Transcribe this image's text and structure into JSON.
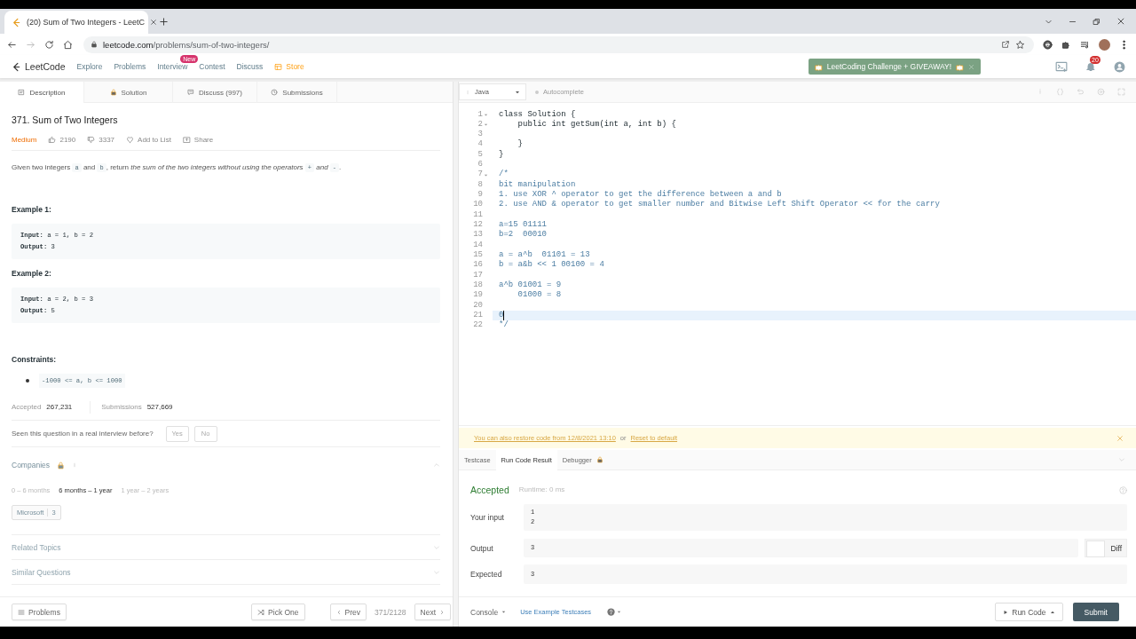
{
  "browser": {
    "tab_title": "(20) Sum of Two Integers - LeetC",
    "url_host": "leetcode.com",
    "url_path": "/problems/sum-of-two-integers/"
  },
  "nav": {
    "logo": "LeetCode",
    "items": [
      {
        "label": "Explore",
        "kind": "link"
      },
      {
        "label": "Problems",
        "kind": "link"
      },
      {
        "label": "Interview",
        "kind": "link",
        "badge": "New"
      },
      {
        "label": "Contest",
        "kind": "link"
      },
      {
        "label": "Discuss",
        "kind": "link"
      },
      {
        "label": "Store",
        "kind": "store"
      }
    ],
    "promo": "LeetCoding Challenge + GIVEAWAY!",
    "notifications": "20"
  },
  "left_tabs": [
    {
      "label": "Description",
      "selected": true
    },
    {
      "label": "Solution",
      "selected": false
    },
    {
      "label": "Discuss (997)",
      "selected": false
    },
    {
      "label": "Submissions",
      "selected": false
    }
  ],
  "problem": {
    "title": "371. Sum of Two Integers",
    "difficulty": "Medium",
    "likes": "2190",
    "dislikes": "3337",
    "add_to_list": "Add to List",
    "share": "Share",
    "description": [
      {
        "kind": "text",
        "text": "Given two integers "
      },
      {
        "kind": "code",
        "text": "a"
      },
      {
        "kind": "text",
        "text": " and "
      },
      {
        "kind": "code",
        "text": "b"
      },
      {
        "kind": "text",
        "text": ", return "
      },
      {
        "kind": "italic",
        "text": "the sum of the two integers without using the operators "
      },
      {
        "kind": "code",
        "text": "+"
      },
      {
        "kind": "italic",
        "text": " and "
      },
      {
        "kind": "code",
        "text": "-"
      },
      {
        "kind": "text",
        "text": "."
      }
    ],
    "examples": [
      {
        "heading": "Example 1:",
        "lines": [
          "**Input:** a = 1, b = 2",
          "**Output:** 3"
        ]
      },
      {
        "heading": "Example 2:",
        "lines": [
          "**Input:** a = 2, b = 3",
          "**Output:** 5"
        ]
      }
    ],
    "constraints_heading": "Constraints:",
    "constraints": [
      "-1000 <= a, b <= 1000"
    ],
    "accepted_label": "Accepted",
    "accepted": "267,231",
    "submissions_label": "Submissions",
    "submissions": "527,669",
    "interview_question": "Seen this question in a real interview before?",
    "answers": [
      "Yes",
      "No"
    ]
  },
  "companies": {
    "title": "Companies",
    "expanded": true,
    "periods": [
      {
        "label": "0 – 6 months",
        "selected": false
      },
      {
        "label": "6 months – 1 year",
        "selected": true
      },
      {
        "label": "1 year – 2 years",
        "selected": false
      }
    ],
    "tags": [
      {
        "name": "Microsoft",
        "count": "3"
      }
    ]
  },
  "sections": [
    {
      "title": "Related Topics",
      "expanded": false
    },
    {
      "title": "Similar Questions",
      "expanded": false
    }
  ],
  "left_footer": {
    "problems": "Problems",
    "pick_one": "Pick One",
    "prev": "Prev",
    "position": "371/2128",
    "next": "Next"
  },
  "editor": {
    "language": "Java",
    "autocomplete": {
      "label": "Autocomplete",
      "on": false
    },
    "lines": [
      {
        "number": "1",
        "text": "class Solution {",
        "kind": "code",
        "fold": true,
        "current": false
      },
      {
        "number": "2",
        "text": "    public int getSum(int a, int b) {",
        "kind": "code",
        "fold": true,
        "current": false
      },
      {
        "number": "3",
        "fold": false,
        "current": false
      },
      {
        "number": "4",
        "text": "    }",
        "kind": "code",
        "fold": false,
        "current": false
      },
      {
        "number": "5",
        "text": "}",
        "kind": "code",
        "fold": false,
        "current": false
      },
      {
        "number": "6",
        "fold": false,
        "current": false
      },
      {
        "number": "7",
        "text": "/*",
        "kind": "comment",
        "fold": true,
        "current": false
      },
      {
        "number": "8",
        "text": "bit manipulation",
        "kind": "comment",
        "fold": false,
        "current": false
      },
      {
        "number": "9",
        "text": "1. use XOR ^ operator to get the difference between a and b",
        "kind": "comment",
        "fold": false,
        "current": false
      },
      {
        "number": "10",
        "text": "2. use AND & operator to get smaller number and Bitwise Left Shift Operator << for the carry",
        "kind": "comment",
        "fold": false,
        "current": false
      },
      {
        "number": "11",
        "fold": false,
        "current": false
      },
      {
        "number": "12",
        "text": "a=15 01111",
        "kind": "comment",
        "fold": false,
        "current": false
      },
      {
        "number": "13",
        "text": "b=2  00010",
        "kind": "comment",
        "fold": false,
        "current": false
      },
      {
        "number": "14",
        "fold": false,
        "current": false
      },
      {
        "number": "15",
        "text": "a = a^b  01101 = 13",
        "kind": "comment",
        "fold": false,
        "current": false
      },
      {
        "number": "16",
        "text": "b = a&b << 1 00100 = 4",
        "kind": "comment",
        "fold": false,
        "current": false
      },
      {
        "number": "17",
        "fold": false,
        "current": false
      },
      {
        "number": "18",
        "text": "a^b 01001 = 9",
        "kind": "comment",
        "fold": false,
        "current": false
      },
      {
        "number": "19",
        "text": "    01000 = 8",
        "kind": "comment",
        "fold": false,
        "current": false
      },
      {
        "number": "20",
        "fold": false,
        "current": false
      },
      {
        "number": "21",
        "text": "0",
        "kind": "comment",
        "fold": false,
        "current": true
      },
      {
        "number": "22",
        "text": "*/",
        "kind": "comment",
        "fold": false,
        "current": false
      }
    ]
  },
  "restore": {
    "message": "You can also restore code from 12/8/2021 13:10",
    "or": "or",
    "reset": "Reset to default"
  },
  "result_tabs": [
    {
      "label": "Testcase",
      "selected": false
    },
    {
      "label": "Run Code Result",
      "selected": true
    },
    {
      "label": "Debugger",
      "selected": false
    }
  ],
  "result": {
    "status": "Accepted",
    "runtime": "Runtime: 0 ms",
    "rows": [
      {
        "label": "Your input",
        "lines": [
          "1",
          "2"
        ]
      },
      {
        "label": "Output",
        "lines": [
          "3"
        ],
        "diff": {
          "label": "Diff",
          "on": false
        }
      },
      {
        "label": "Expected",
        "lines": [
          "3"
        ]
      }
    ]
  },
  "right_footer": {
    "console": "Console",
    "testcases": "Use Example Testcases",
    "run": "Run Code",
    "submit": "Submit"
  }
}
